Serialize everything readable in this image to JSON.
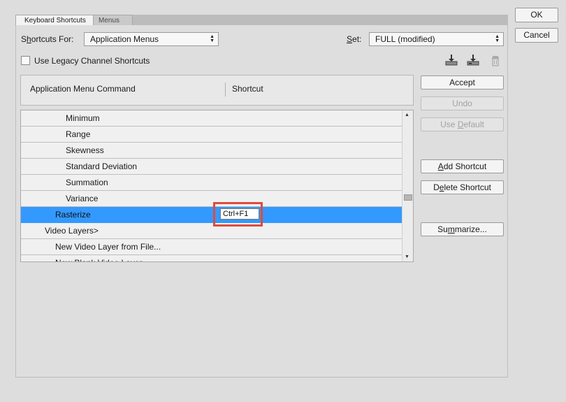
{
  "tabs": [
    {
      "label": "Keyboard Shortcuts",
      "active": true
    },
    {
      "label": "Menus",
      "active": false
    }
  ],
  "shortcuts_for": {
    "label_prefix": "S",
    "label_underline": "h",
    "label_suffix": "ortcuts For:",
    "value": "Application Menus"
  },
  "set": {
    "label_underline": "S",
    "label_suffix": "et:",
    "value": "FULL (modified)"
  },
  "legacy_checkbox": {
    "label": "Use Legacy Channel Shortcuts",
    "checked": false
  },
  "toolbar_icons": [
    "save-set-icon",
    "save-set-as-icon",
    "delete-set-icon"
  ],
  "list_header": {
    "command": "Application Menu Command",
    "shortcut": "Shortcut"
  },
  "rows": [
    {
      "label": "Minimum",
      "indent": 2
    },
    {
      "label": "Range",
      "indent": 2
    },
    {
      "label": "Skewness",
      "indent": 2
    },
    {
      "label": "Standard Deviation",
      "indent": 2
    },
    {
      "label": "Summation",
      "indent": 2
    },
    {
      "label": "Variance",
      "indent": 2
    },
    {
      "label": "Rasterize",
      "indent": 1,
      "selected": true,
      "shortcut": "Ctrl+F1"
    },
    {
      "label": "Video Layers>",
      "indent": 0
    },
    {
      "label": "New Video Layer from File...",
      "indent": 1
    },
    {
      "label": "New Blank Video Layer",
      "indent": 1
    }
  ],
  "side_buttons": {
    "accept": "Accept",
    "undo": "Undo",
    "use_default_pre": "Use ",
    "use_default_u": "D",
    "use_default_post": "efault",
    "add_shortcut_u": "A",
    "add_shortcut_post": "dd Shortcut",
    "delete_pre": "D",
    "delete_u": "e",
    "delete_post": "lete Shortcut",
    "summarize_pre": "Su",
    "summarize_u": "m",
    "summarize_post": "marize..."
  },
  "dialog_buttons": {
    "ok": "OK",
    "cancel": "Cancel"
  },
  "colors": {
    "selection": "#3399ff",
    "highlight_box": "#e04a3c"
  }
}
